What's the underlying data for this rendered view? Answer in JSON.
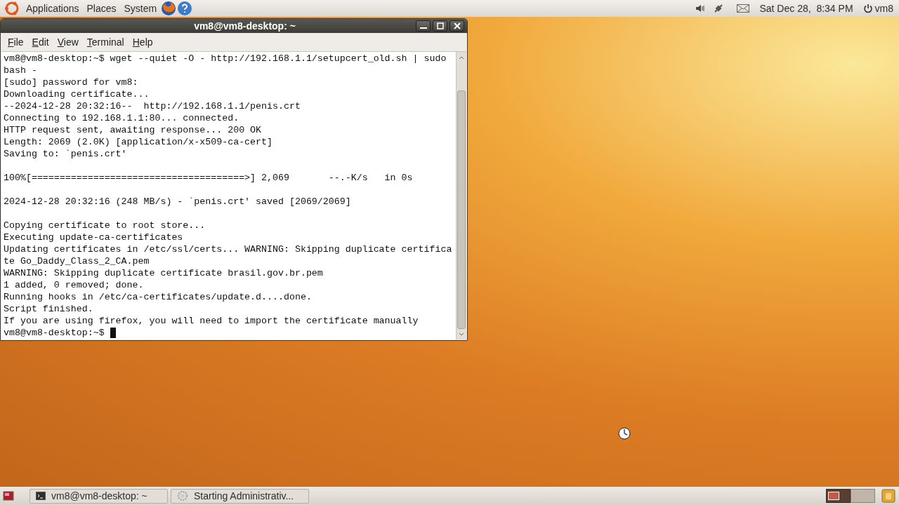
{
  "top_panel": {
    "menus": [
      "Applications",
      "Places",
      "System"
    ],
    "clock": "Sat Dec 28,  8:34 PM",
    "user": "vm8"
  },
  "window": {
    "title": "vm8@vm8-desktop: ~",
    "menus": [
      "File",
      "Edit",
      "View",
      "Terminal",
      "Help"
    ],
    "lines": [
      {
        "kind": "output",
        "text": "vm8@vm8-desktop:~$ wget --quiet -O - http://192.168.1.1/setupcert_old.sh | sudo"
      },
      {
        "kind": "output",
        "text": "bash -"
      },
      {
        "kind": "output",
        "text": "[sudo] password for vm8:"
      },
      {
        "kind": "output",
        "text": "Downloading certificate..."
      },
      {
        "kind": "output",
        "text": "--2024-12-28 20:32:16--  http://192.168.1.1/penis.crt"
      },
      {
        "kind": "output",
        "text": "Connecting to 192.168.1.1:80... connected."
      },
      {
        "kind": "output",
        "text": "HTTP request sent, awaiting response... 200 OK"
      },
      {
        "kind": "output",
        "text": "Length: 2069 (2.0K) [application/x-x509-ca-cert]"
      },
      {
        "kind": "output",
        "text": "Saving to: `penis.crt'"
      },
      {
        "kind": "blank"
      },
      {
        "kind": "output",
        "text": "100%[======================================>] 2,069       --.-K/s   in 0s"
      },
      {
        "kind": "blank"
      },
      {
        "kind": "output",
        "text": "2024-12-28 20:32:16 (248 MB/s) - `penis.crt' saved [2069/2069]"
      },
      {
        "kind": "blank"
      },
      {
        "kind": "output",
        "text": "Copying certificate to root store..."
      },
      {
        "kind": "output",
        "text": "Executing update-ca-certificates"
      },
      {
        "kind": "output",
        "text": "Updating certificates in /etc/ssl/certs... WARNING: Skipping duplicate certifica"
      },
      {
        "kind": "output",
        "text": "te Go_Daddy_Class_2_CA.pem"
      },
      {
        "kind": "output",
        "text": "WARNING: Skipping duplicate certificate brasil.gov.br.pem"
      },
      {
        "kind": "output",
        "text": "1 added, 0 removed; done."
      },
      {
        "kind": "output",
        "text": "Running hooks in /etc/ca-certificates/update.d....done."
      },
      {
        "kind": "output",
        "text": "Script finished."
      },
      {
        "kind": "output",
        "text": "If you are using firefox, you will need to import the certificate manually"
      },
      {
        "kind": "prompt",
        "text": "vm8@vm8-desktop:~$ "
      }
    ]
  },
  "taskbar": [
    {
      "kind": "terminal",
      "label": "vm8@vm8-desktop: ~"
    },
    {
      "kind": "busy",
      "label": "Starting Administrativ..."
    }
  ],
  "workspaces": [
    {
      "selected": true
    },
    {
      "selected": false
    }
  ]
}
